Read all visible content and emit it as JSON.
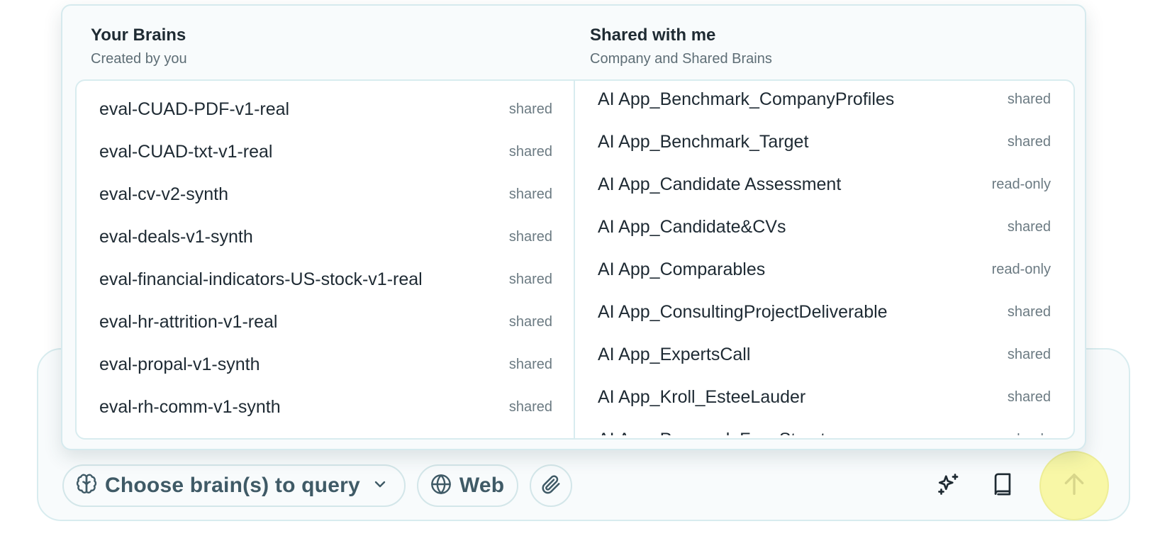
{
  "composer": {
    "brain_selector_label": "Choose brain(s) to query",
    "web_label": "Web"
  },
  "dropdown": {
    "your_brains": {
      "title": "Your Brains",
      "subtitle": "Created by you",
      "items": [
        {
          "name": "eval-CUAD-PDF-v1-real",
          "tag": "shared"
        },
        {
          "name": "eval-CUAD-txt-v1-real",
          "tag": "shared"
        },
        {
          "name": "eval-cv-v2-synth",
          "tag": "shared"
        },
        {
          "name": "eval-deals-v1-synth",
          "tag": "shared"
        },
        {
          "name": "eval-financial-indicators-US-stock-v1-real",
          "tag": "shared"
        },
        {
          "name": "eval-hr-attrition-v1-real",
          "tag": "shared"
        },
        {
          "name": "eval-propal-v1-synth",
          "tag": "shared"
        },
        {
          "name": "eval-rh-comm-v1-synth",
          "tag": "shared"
        }
      ]
    },
    "shared_with_me": {
      "title": "Shared with me",
      "subtitle": "Company and Shared Brains",
      "items": [
        {
          "name": "AI App_Benchmark_CompanyProfiles",
          "tag": "shared"
        },
        {
          "name": "AI App_Benchmark_Target",
          "tag": "shared"
        },
        {
          "name": "AI App_Candidate Assessment",
          "tag": "read-only"
        },
        {
          "name": "AI App_Candidate&CVs",
          "tag": "shared"
        },
        {
          "name": "AI App_Comparables",
          "tag": "read-only"
        },
        {
          "name": "AI App_ConsultingProjectDeliverable",
          "tag": "shared"
        },
        {
          "name": "AI App_ExpertsCall",
          "tag": "shared"
        },
        {
          "name": "AI App_Kroll_EsteeLauder",
          "tag": "shared"
        },
        {
          "name": "AI App_Proposal_FeesStructure",
          "tag": "read-only"
        }
      ]
    }
  },
  "icons": {
    "brain_selector": "brain-icon",
    "dropdown_arrow": "chevron-down-icon",
    "web": "globe-icon",
    "attach": "paperclip-icon",
    "sparkle": "sparkles-icon",
    "library": "book-icon",
    "send": "arrow-up-icon"
  },
  "colors": {
    "accent_send": "#f8f7a6",
    "border": "#d8ecef",
    "panel_bg": "#f8fbfc"
  }
}
